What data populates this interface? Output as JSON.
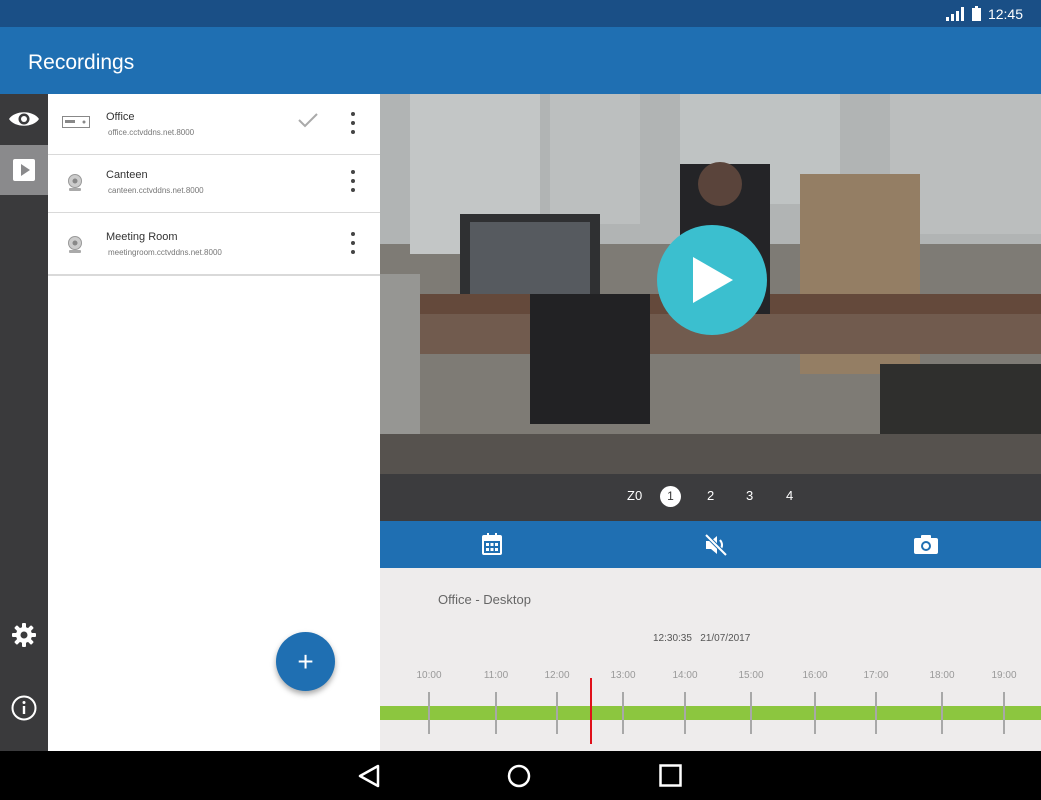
{
  "status": {
    "time": "12:45"
  },
  "app": {
    "title": "Recordings"
  },
  "rail": [
    {
      "icon": "eye-icon",
      "active": false
    },
    {
      "icon": "play-box-icon",
      "active": true
    },
    {
      "icon": "gear-icon",
      "active": false
    },
    {
      "icon": "info-icon",
      "active": false
    }
  ],
  "devices": [
    {
      "name": "Office",
      "host": "office.cctvddns.net.8000",
      "icon": "dvr-icon",
      "selected": true
    },
    {
      "name": "Canteen",
      "host": "canteen.cctvddns.net.8000",
      "icon": "webcam-icon",
      "selected": false
    },
    {
      "name": "Meeting Room",
      "host": "meetingroom.cctvddns.net.8000",
      "icon": "webcam-icon",
      "selected": false
    }
  ],
  "fab": {
    "label": "+"
  },
  "channels": {
    "zoom": "Z0",
    "items": [
      "1",
      "2",
      "3",
      "4"
    ],
    "selected": "1"
  },
  "toolbar": {
    "icons": [
      "calendar-icon",
      "mute-icon",
      "camera-icon"
    ]
  },
  "timeline": {
    "camera": "Office - Desktop",
    "timestamp": "12:30:35   21/07/2017",
    "hours": [
      "10:00",
      "11:00",
      "12:00",
      "13:00",
      "14:00",
      "15:00",
      "16:00",
      "17:00",
      "18:00",
      "19:00"
    ]
  },
  "colors": {
    "primary": "#1f6fb2",
    "accent": "#3bbfcf",
    "recorded": "#8cc63f",
    "cursor": "#e0101a"
  }
}
